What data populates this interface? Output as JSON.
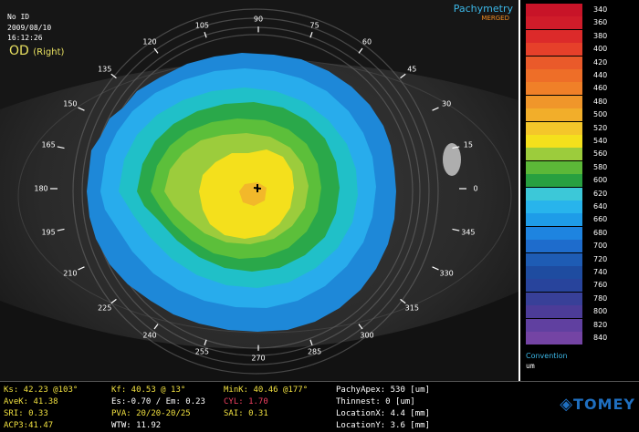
{
  "header": {
    "id": "No ID",
    "date": "2009/08/10",
    "time": "16:12:26"
  },
  "eye": {
    "code": "OD",
    "side": "(Right)"
  },
  "map": {
    "title": "Pachymetry",
    "subtitle": "MERGED"
  },
  "axis_labels": [
    "0",
    "15",
    "30",
    "45",
    "60",
    "75",
    "90",
    "105",
    "120",
    "135",
    "150",
    "165",
    "180",
    "195",
    "210",
    "225",
    "240",
    "255",
    "270",
    "285",
    "300",
    "315",
    "330",
    "345"
  ],
  "scale": {
    "values": [
      "340",
      "360",
      "380",
      "400",
      "420",
      "440",
      "460",
      "480",
      "500",
      "520",
      "540",
      "560",
      "580",
      "600",
      "620",
      "640",
      "660",
      "680",
      "700",
      "720",
      "740",
      "760",
      "780",
      "800",
      "820",
      "840"
    ],
    "colors": [
      "#c81428",
      "#d01c2a",
      "#dc2a2a",
      "#e6402a",
      "#ea5a2a",
      "#ee6e28",
      "#f08028",
      "#f0962a",
      "#f2ae2a",
      "#f4c62a",
      "#f4e01c",
      "#9ccc3c",
      "#5cb838",
      "#28a040",
      "#3cc8d8",
      "#28b4ec",
      "#1e9ce8",
      "#1e84e0",
      "#1e6ccc",
      "#1e5cb4",
      "#1e4ca0",
      "#28449c",
      "#384098",
      "#4c3c98",
      "#6040a0",
      "#7444a4"
    ],
    "convention": "Convention",
    "unit": "um"
  },
  "measurements": {
    "ks": "Ks: 42.23 @103°",
    "avek": "AveK: 41.38",
    "sri": "SRI: 0.33",
    "acp": "ACP3:41.47",
    "kf": "Kf: 40.53 @ 13°",
    "es_em": "Es:-0.70 / Em: 0.23",
    "pva": "PVA: 20/20-20/25",
    "wtw": "WTW: 11.92",
    "mink": "MinK: 40.46 @177°",
    "cyl": "CYL: 1.70",
    "sai": "SAI: 0.31",
    "pachy_apex": "PachyApex: 530 [um]",
    "thinnest": "Thinnest: 0 [um]",
    "location_x": "LocationX: 4.4 [mm]",
    "location_y": "LocationY: 3.6 [mm]"
  },
  "logo": {
    "text": "TOMEY",
    "glyph": "◈"
  },
  "colors": {
    "accent_cyan": "#3cb8e8",
    "merged_orange": "#f08a20",
    "od_yellow": "#e8e060",
    "value_yellow": "#f0e040",
    "value_pink": "#f04060"
  }
}
